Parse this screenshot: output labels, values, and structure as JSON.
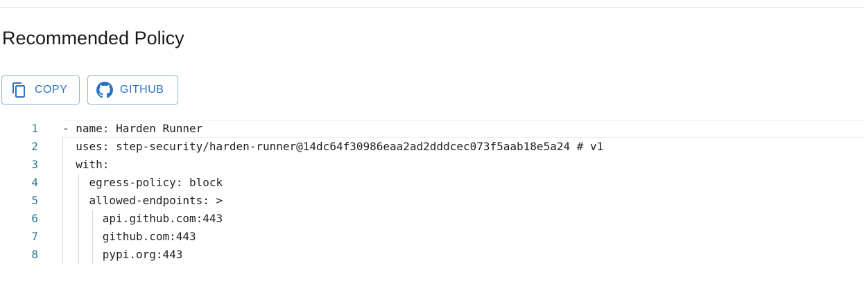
{
  "section": {
    "title": "Recommended Policy"
  },
  "toolbar": {
    "copy_label": "COPY",
    "copy_icon": "copy-icon",
    "github_label": "GITHUB",
    "github_icon": "github-icon",
    "accent_color": "#2a73c2"
  },
  "editor": {
    "lines": [
      {
        "number": "1",
        "text": "- name: Harden Runner"
      },
      {
        "number": "2",
        "text": "  uses: step-security/harden-runner@14dc64f30986eaa2ad2dddcec073f5aab18e5a24 # v1"
      },
      {
        "number": "3",
        "text": "  with:"
      },
      {
        "number": "4",
        "text": "    egress-policy: block"
      },
      {
        "number": "5",
        "text": "    allowed-endpoints: >"
      },
      {
        "number": "6",
        "text": "      api.github.com:443"
      },
      {
        "number": "7",
        "text": "      github.com:443"
      },
      {
        "number": "8",
        "text": "      pypi.org:443"
      }
    ]
  }
}
